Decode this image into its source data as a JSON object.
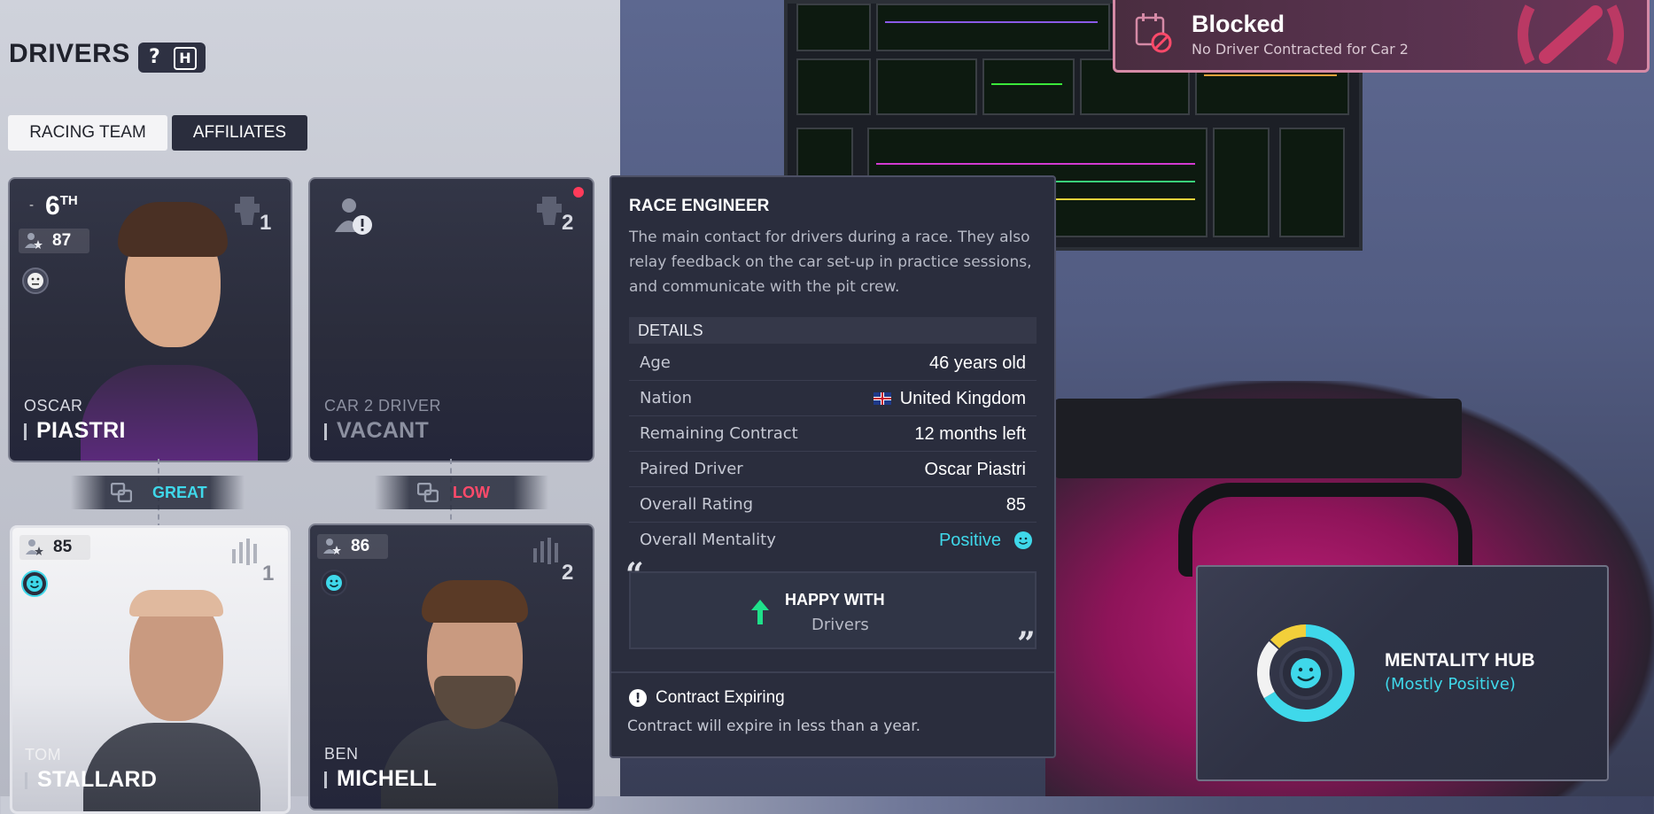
{
  "header": {
    "title": "DRIVERS",
    "help_key": "?",
    "hotkey": "H"
  },
  "tabs": [
    {
      "label": "RACING TEAM",
      "active": true
    },
    {
      "label": "AFFILIATES",
      "active": false
    }
  ],
  "cards": {
    "driver1": {
      "position_change": "-",
      "position": "6",
      "position_suffix": "TH",
      "rating": "87",
      "car_number": "1",
      "first_name": "OSCAR",
      "last_name": "PIASTRI",
      "mood": "neutral"
    },
    "driver2": {
      "car_number": "2",
      "first_name": "CAR 2 DRIVER",
      "last_name": "VACANT"
    },
    "engineer1": {
      "rating": "85",
      "car_number": "1",
      "first_name": "TOM",
      "last_name": "STALLARD",
      "mood": "happy"
    },
    "engineer2": {
      "rating": "86",
      "car_number": "2",
      "first_name": "BEN",
      "last_name": "MICHELL",
      "mood": "happy"
    }
  },
  "chemistry": [
    {
      "label": "GREAT",
      "color": "#3fd8ea"
    },
    {
      "label": "LOW",
      "color": "#ff4a6a"
    }
  ],
  "tooltip": {
    "title": "RACE ENGINEER",
    "description": "The main contact for drivers during a race. They also relay feedback on the car set-up in practice sessions, and communicate with the pit crew.",
    "details_header": "DETAILS",
    "details": [
      {
        "key": "Age",
        "value": "46 years old"
      },
      {
        "key": "Nation",
        "value": "United Kingdom"
      },
      {
        "key": "Remaining Contract",
        "value": "12 months left"
      },
      {
        "key": "Paired Driver",
        "value": "Oscar Piastri"
      },
      {
        "key": "Overall Rating",
        "value": "85"
      },
      {
        "key": "Overall Mentality",
        "value": "Positive"
      }
    ],
    "happy_with_label": "HAPPY WITH",
    "happy_with_value": "Drivers",
    "warning_title": "Contract Expiring",
    "warning_desc": "Contract will expire in less than a year."
  },
  "notification": {
    "title": "Blocked",
    "message": "No Driver Contracted for Car 2"
  },
  "mentality_hub": {
    "title": "MENTALITY HUB",
    "subtitle": "(Mostly Positive)"
  },
  "colors": {
    "positive": "#3fd8ea",
    "negative": "#ff4a6a",
    "panel": "#2a2d3d",
    "notification_border": "#d58aa6"
  }
}
